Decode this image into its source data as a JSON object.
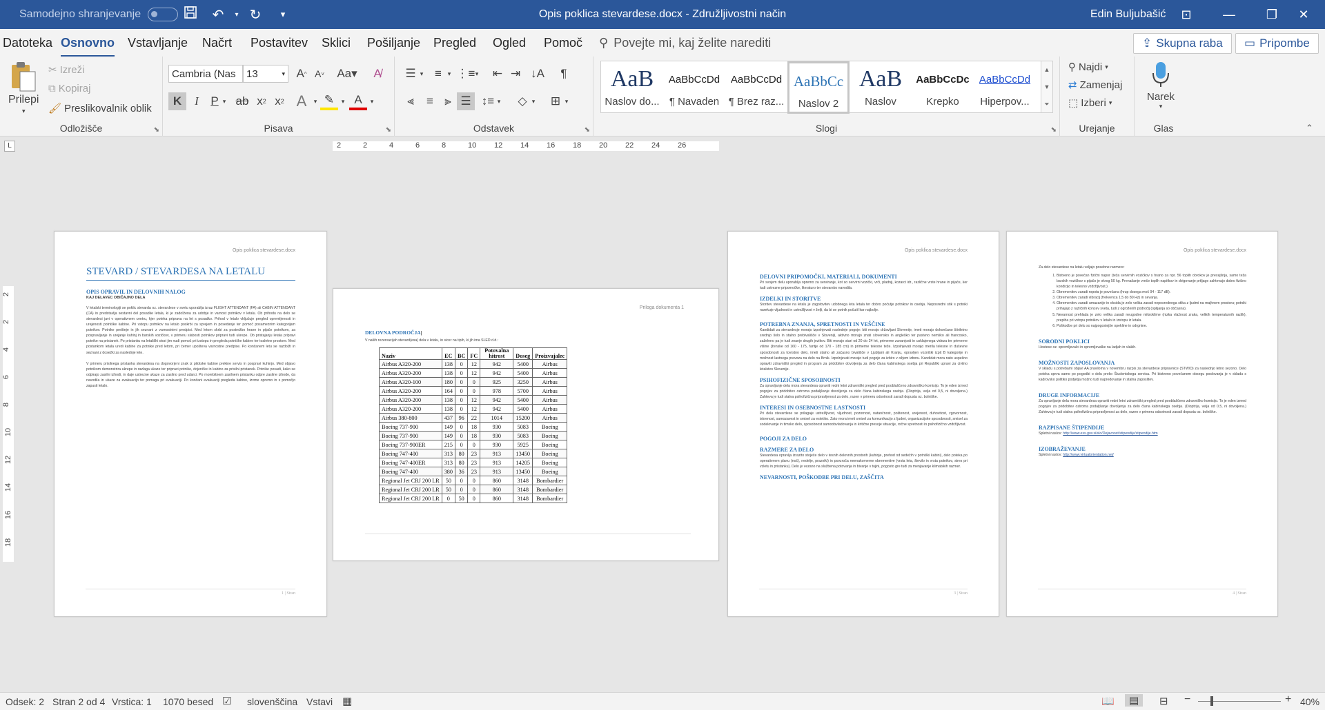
{
  "titlebar": {
    "autosave_label": "Samodejno shranjevanje",
    "title": "Opis poklica stevardese.docx  -  Združljivostni način",
    "user": "Edin Buljubašić"
  },
  "tabs": [
    "Datoteka",
    "Osnovno",
    "Vstavljanje",
    "Načrt",
    "Postavitev",
    "Sklici",
    "Pošiljanje",
    "Pregled",
    "Ogled",
    "Pomoč"
  ],
  "tell_me": "Povejte mi, kaj želite narediti",
  "share_label": "Skupna raba",
  "comments_label": "Pripombe",
  "ribbon": {
    "clipboard": {
      "label": "Odložišče",
      "paste": "Prilepi",
      "cut": "Izreži",
      "copy": "Kopiraj",
      "format_painter": "Preslikovalnik oblik"
    },
    "font": {
      "label": "Pisava",
      "font_name": "Cambria (Nas",
      "font_size": "13"
    },
    "paragraph": {
      "label": "Odstavek"
    },
    "styles": {
      "label": "Slogi",
      "items": [
        {
          "preview": "AaB",
          "name": "Naslov do..."
        },
        {
          "preview": "AaBbCcDd",
          "name": "¶ Navaden"
        },
        {
          "preview": "AaBbCcDd",
          "name": "¶ Brez raz..."
        },
        {
          "preview": "AaBbCc",
          "name": "Naslov 2"
        },
        {
          "preview": "AaB",
          "name": "Naslov"
        },
        {
          "preview": "AaBbCcDc",
          "name": "Krepko"
        },
        {
          "preview": "AaBbCcDd",
          "name": "Hiperpov..."
        }
      ]
    },
    "editing": {
      "label": "Urejanje",
      "find": "Najdi",
      "replace": "Zamenjaj",
      "select": "Izberi"
    },
    "voice": {
      "label": "Glas",
      "dictate": "Narek"
    }
  },
  "ruler": {
    "h_ticks": [
      "2",
      "2",
      "4",
      "6",
      "8",
      "10",
      "12",
      "14",
      "16",
      "18",
      "20",
      "22",
      "24",
      "26"
    ],
    "v_ticks": [
      "2",
      "2",
      "4",
      "6",
      "8",
      "10",
      "12",
      "14",
      "16",
      "18"
    ]
  },
  "page1": {
    "header": "Opis poklica stevardese.docx",
    "title": "STEVARD / STEVARDESA NA LETALU",
    "sec1": "OPIS OPRAVIL IN DELOVNIH NALOG",
    "sub1": "KAJ DELAVEC OBIČAJNO DELA",
    "p1": "V letalski terminologiji se poklic stevarda oz. stevardese v svetu uporablja izraz FLIGHT ATTENDANT (FA) ali CABIN ATTENDANT (CA) in predstavlja sestavni del posadke letala, ki je zadolžena za udobje in varnost potnikov v letalu. Ob prihodu na delo se stevardesi javi v operativnem centru, kjer poteka priprava na let s posadko. Prihod v letalo vključuje pregled opremljenosti in urejenosti potniške kabine. Pri vstopu potnikov na letalo poskrbi za sprejem in posedanje ter pomoč posameznim kategorijam potnikov. Potnike prešteje in jih seznani z varnostnimi predpisi. Med letom skrbi za postrežbo hrane in pijače potnikom, za pospravljanje in urejanje kuhinj in barskih vozičkov, v primeru slabosti potnikov pripravi tudi ukrepe. Ob pristajanju letala pripravi potnike na pristanek. Po pristanku na letališki stezi jim nudi pomoč pri izstopu in pregleda potniške kabine ter toaletne prostore. Med postankom letala uredi kabine za potnike pred letom, pri čemer upošteva varnostne predpise. Po končanem letu se razdolži in seznani z dosežki za naslednje lete.",
    "p2": "V primeru prisilnega pristanka stevardesa na dogovorjeni znak iz pilotske kabine prekine servis in pospravi kuhinjo. Med objavo potnikom demonstrira ukrepe in razlaga ukaze ter pripravi potnike, dojenčke in kabino za prisilni pristanek. Potnike posadi, kako se odpirajo zasilni izhodi, in daje ustrezne ukaze za zasilno pred udarci. Po morebitnem zasilnem pristanku odpre zasilne izhode, da navodila in ukaze za evakuacijo ter pomaga pri evakuaciji. Po končani evakuaciji pregleda kabino, izvrne opremo in s pomočjo zapusti letalo.",
    "footer": "1 | Stran"
  },
  "page2": {
    "header": "Priloga dokumenta 1",
    "title": "DELOVNA PODROČJA",
    "intro": "V naših rezervacijah stevard(esa) dela v letalu, in sicer na tipih, ki jih ima SLED d.d.:",
    "columns": [
      "Naziv",
      "EC",
      "BC",
      "FC",
      "Potovalna hitrost",
      "Doseg",
      "Proizvajalec"
    ],
    "rows": [
      [
        "Airbus A320-200",
        "138",
        "0",
        "12",
        "942",
        "5400",
        "Airbus"
      ],
      [
        "Airbus A320-200",
        "138",
        "0",
        "12",
        "942",
        "5400",
        "Airbus"
      ],
      [
        "Airbus A320-100",
        "180",
        "0",
        "0",
        "925",
        "3250",
        "Airbus"
      ],
      [
        "Airbus A320-200",
        "164",
        "0",
        "0",
        "978",
        "5700",
        "Airbus"
      ],
      [
        "Airbus A320-200",
        "138",
        "0",
        "12",
        "942",
        "5400",
        "Airbus"
      ],
      [
        "Airbus A320-200",
        "138",
        "0",
        "12",
        "942",
        "5400",
        "Airbus"
      ],
      [
        "Airbus 380-800",
        "437",
        "96",
        "22",
        "1014",
        "15200",
        "Airbus"
      ],
      [
        "Boeing 737-900",
        "149",
        "0",
        "18",
        "930",
        "5083",
        "Boeing"
      ],
      [
        "Boeing 737-900",
        "149",
        "0",
        "18",
        "930",
        "5083",
        "Boeing"
      ],
      [
        "Boeing 737-900ER",
        "215",
        "0",
        "0",
        "930",
        "5925",
        "Boeing"
      ],
      [
        "Boeing 747-400",
        "313",
        "80",
        "23",
        "913",
        "13450",
        "Boeing"
      ],
      [
        "Boeing 747-400ER",
        "313",
        "80",
        "23",
        "913",
        "14205",
        "Boeing"
      ],
      [
        "Boeing 747-400",
        "380",
        "36",
        "23",
        "913",
        "13450",
        "Boeing"
      ],
      [
        "Regional Jet CRJ 200 LR",
        "50",
        "0",
        "0",
        "860",
        "3148",
        "Bombardier"
      ],
      [
        "Regional Jet CRJ 200 LR",
        "50",
        "0",
        "0",
        "860",
        "3148",
        "Bombardier"
      ],
      [
        "Regional Jet CRJ 200 LR",
        "0",
        "50",
        "0",
        "860",
        "3148",
        "Bombardier"
      ]
    ]
  },
  "page3": {
    "header": "Opis poklica stevardese.docx",
    "s1": "DELOVNI PRIPOMOČKI, MATERIALI, DOKUMENTI",
    "p1": "Pri svojem delu uporablja opremo za serviranje, kot so servirni vozički, vrči, pladnji, kozarci idr., različne vrste hrane in pijače, ker tudi ustrezne pripomočke, literaturo ter stevarsko navodila.",
    "s2": "IZDELKI IN STORITVE",
    "p2": "Storitev stevardese na letalu je zagotovitev udobnega leta letala ter dobro počutje potnikov in osebja. Neposredni stik s potniki narekuje vljudnost in ustrežljivost v želji, da bi se potnik počutil kar najbolje.",
    "s3": "POTREBNA ZNANJA, SPRETNOSTI IN VEŠČINE",
    "p3": "Kandidati za stevardesje morajo izpolnjevati naslednje pogoje: biti morajo državljani Slovenije, imeti morajo dokončano štiriletno srednjo šolo in stalno prebivališče v Sloveniji, aktivno morajo znati slovensko in angleško ter pasivno nemško ali francosko, zaželeno pa je tudi znanje drugih jezikov. Biti morajo stari od 20 do 24 let, primerne zunanjosti in usklajenega videza ter primerne višine (ženske od 160 - 175, fantje od 170 - 185 cm) in primerne telesne teže. Izpolnjevati morajo merila telesne in duševne sposobnosti za tovrstno delo, imeti stalno ali začasno bivališče v Ljubljani ali Kranju, opravljen vozniški izpit B kategorije in možnost lastnega prevoza na delo na Brnik. Izpolnjevati morajo tudi pogoje za izbiro v ožjem izboru. Kandidat mora nato uspešno opraviti zdravniški pregled in program za pridobitev dovoljenja za delo člana kabinskega osebja pri Republiki upravi za civilno letalstvo Slovenije.",
    "s4": "PSIHOFIZIČNE SPOSOBNOSTI",
    "p4": "Za opravljanje dela mora stevardesa opraviti redni letni zdravniški pregled pred pooblaščeno zdravniško komisijo. To je eden izmed pogojev za pridobitev oziroma podaljšanje dovoljenja za delo člana kabinskega osebja. (Dioptrija, velja od 0,5, ni dovoljena.) Zahteva je tudi stalna psihofizična pripravljenost za delo, razen v primeru odsotnosti zaradi dopusta oz. bolniške.",
    "s5": "INTERESI IN OSEBNOSTNE LASTNOSTI",
    "p5": "Pri delu stevardese se prilagaje ustrežljivost, vljudnost, pozornost, natančnost, poštenost, urejenost, duhovitost, zgovornost, iskrenost, samozavest in smisel za estetiko. Zato mora imeti smisel za komunikacijo z ljudmi, organizacijske sposobnosti, smisel za sodelovanje in timsko delo, sposobnost samoobvladovanja in kritične presoje situacije, ročne spretnosti in psihofizično vzdržljivost.",
    "s6": "POGOJI ZA DELO",
    "s7": "RAZMERE ZA DELO",
    "p7": "Stevardesa opravlja izrazito stoječe delo v tesnih delovnih prostorih (kuhinje, prehod od sedežih v potniški kabini), delo poteka po operativnem planu (noč), nedelje, prazniki) in povzroča neenakomerne obremenitve (vrsta leta, število in vrsta potnikov, stres pri vzletu in pristanku). Delo je vezano na službena potovanja in bivanje v tujini, pogosto gre tudi za menjavanje klimatskih razmer.",
    "s8": "NEVARNOSTI, POŠKODBE PRI DELU, ZAŠČITA",
    "footer": "3 | Stran"
  },
  "page4": {
    "header": "Opis poklica stevardese.docx",
    "intro": "Za delo stevardese na letalu veljajo posebne razmere:",
    "list": [
      "Bistveno je povečan fizični napor (teža servirnih vozičkov s hrano za npr. 56 toplih obrokov je precejšnja, samo teža barskih vozičkov s pijačo je okrog 50 kg. Prenašanje vreče toplih napitkov in dvigovanje prtljage zahtevajo dobro fizično kondicijo in telesno vzdržljivost.)",
      "Obremenitev zaradi ropota je povečana (hrup dosega moč 94 - 117 dB).",
      "Obremenitev zaradi vibracij (frekvenca 1,5 do 80 Hz) in sevanja.",
      "Obremenitev zaradi umazanije in oksida je zelo velika zaradi neposrednega stika z ljudmi na majhnem prostoru; potniki prihajajo z različnih koncev sveta, tudi z ogroženih področij (oplijanja so občasna).",
      "Nevarnost prehlada je zelo velika zaradi neugodne mikroklime (nizka vlažnost zraka, velikih temperaturnih razlik), prepiha pri vstopu potnikov v letalo in izstopu iz letala.",
      "Poškodbe pri delu so najpogostejše opekline in odrgnine."
    ],
    "s1": "SORODNI POKLICI",
    "p1": "Hostese oz. spremljevalci in spremljevalke na ladjah in vlakih.",
    "s2": "MOŽNOSTI ZAPOSLOVANJA",
    "p2": "V skladu s potrebami objavi AA praviloma v novembru razpis za stevardese pripravnice (STW/D) za naslednjo letno sezono. Delo poteka sprva samo po pogodbi o delu preko Študentskega servisa. Pri bistveno povečanem obsegu poslovanja je v skladu s kadrovsko politiko podjetja možno tudi napredovanje in stalna zaposlitev.",
    "s3": "DRUGE INFORMACIJE",
    "p3": "Za opravljanje dela mora stevardesa opraviti redni letni zdravniški pregled pred pooblaščeno zdravniško komisijo. To je eden izmed pogojev za pridobitev oziroma podaljšanje dovoljenja za delo člana kabinskega osebja. (Dioptrija, velja od 0,5, ni dovoljena.) Zahteva je tudi stalna psihofizična pripravljenost za delo, razen v primeru odsotnosti zaradi dopusta oz. bolniške.",
    "s4": "RAZPISANE ŠTIPENDIJE",
    "p4_prefix": "Spletni naslov: ",
    "p4_link": "http://www.ess.gov.si/slo/Dejavnost/stipendije/stipendije.htm",
    "s5": "IZOBRAŽEVANJE",
    "p5_prefix": "Spletni naslov: ",
    "p5_link": "http://www.virtualorientation.net/",
    "footer": "4 | Stran"
  },
  "status": {
    "section": "Odsek: 2",
    "page": "Stran 2 od 4",
    "line": "Vrstica: 1",
    "words": "1070 besed",
    "language": "slovenščina",
    "mode": "Vstavi",
    "zoom": "40%"
  }
}
